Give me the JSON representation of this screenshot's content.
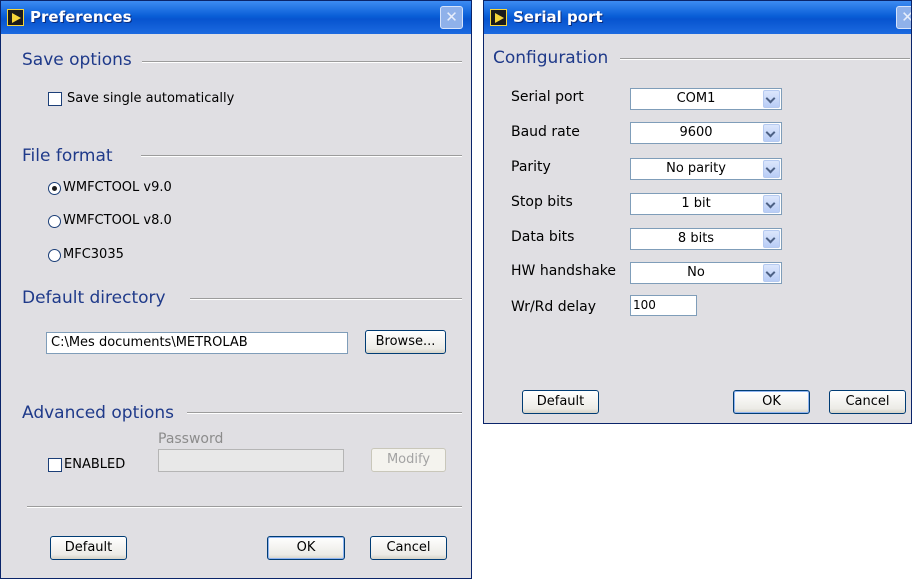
{
  "preferences": {
    "title": "Preferences",
    "save_options": {
      "title": "Save options",
      "save_single_label": "Save single automatically"
    },
    "file_format": {
      "title": "File format",
      "options": [
        "WMFCTOOL v9.0",
        "WMFCTOOL v8.0",
        "MFC3035"
      ],
      "selected": "WMFCTOOL v9.0"
    },
    "default_directory": {
      "title": "Default directory",
      "path": "C:\\Mes documents\\METROLAB",
      "browse_label": "Browse..."
    },
    "advanced_options": {
      "title": "Advanced options",
      "enabled_label": "ENABLED",
      "password_label": "Password",
      "password_value": "",
      "modify_label": "Modify"
    },
    "buttons": {
      "default": "Default",
      "ok": "OK",
      "cancel": "Cancel"
    }
  },
  "serial_port": {
    "title": "Serial port",
    "configuration_title": "Configuration",
    "fields": {
      "serial_port": {
        "label": "Serial port",
        "value": "COM1"
      },
      "baud_rate": {
        "label": "Baud rate",
        "value": "9600"
      },
      "parity": {
        "label": "Parity",
        "value": "No parity"
      },
      "stop_bits": {
        "label": "Stop bits",
        "value": "1 bit"
      },
      "data_bits": {
        "label": "Data bits",
        "value": "8 bits"
      },
      "hw_handshake": {
        "label": "HW handshake",
        "value": "No"
      }
    },
    "wr_rd_delay": {
      "label": "Wr/Rd delay",
      "value": "100"
    },
    "buttons": {
      "default": "Default",
      "ok": "OK",
      "cancel": "Cancel"
    }
  },
  "colors": {
    "titlebar": "#0754cf",
    "dialog_bg": "#e0dfe3",
    "section_title": "#1f3a8a"
  },
  "icons": [
    "labview-app-icon",
    "close-icon",
    "chevron-down-icon"
  ]
}
